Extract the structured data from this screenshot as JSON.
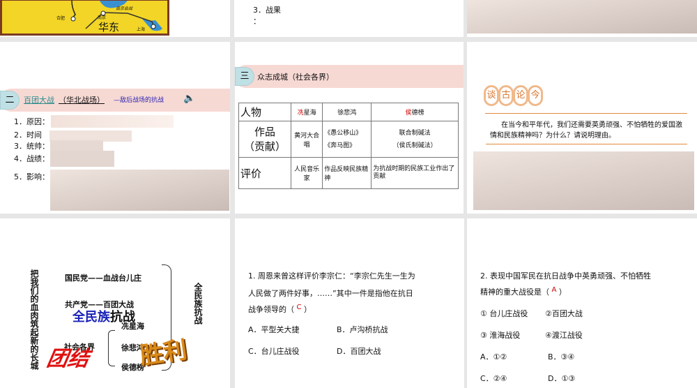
{
  "slides": {
    "map": {
      "labels": {
        "region": "华东",
        "hefei": "合肥",
        "nanjing": "南京",
        "shanghai": "上海",
        "battle": "南京会战"
      },
      "colors": {
        "land": "#f2d526",
        "water": "#3a8fd0",
        "border": "#7a3a22"
      }
    },
    "result": {
      "item": "3．战果",
      "colon": "："
    },
    "section2": {
      "badge": "二",
      "title": "百团大战",
      "subtitle": "（华北战场）",
      "tagline": "—敌后战场的抗战",
      "items": [
        "1．原因：",
        "2．时间",
        "3．统帅：",
        "4．战绩：",
        "5．影响："
      ]
    },
    "section3": {
      "badge": "三",
      "title": "众志成城（社会各界）",
      "table": {
        "row_headers": [
          "人物",
          "作品\n（贡献）",
          "评价"
        ],
        "people": [
          {
            "first": "冼",
            "rest": "星海",
            "highlight": true
          },
          {
            "first": "",
            "rest": "徐悲鸿",
            "highlight": false
          },
          {
            "first": "侯",
            "rest": "德榜",
            "highlight": true
          }
        ],
        "works": [
          "黄河大合唱",
          "《愚公移山》\n《奔马图》",
          "联合制碱法\n（侯氏制碱法）"
        ],
        "evaluations": [
          "人民音乐家",
          "作品反映民族精神",
          "为抗战时期的民族工业作出了贡献"
        ]
      }
    },
    "talk": {
      "rings": [
        "谈",
        "古",
        "论",
        "今"
      ],
      "question": "在当今和平年代，我们还需要英勇顽强、不怕牺牲的爱国激情和民族精神吗？为什么？请说明理由。"
    },
    "summary": {
      "left_vertical": "把我们的血肉筑起新的长城",
      "kmt": "国民党——血战台儿庄",
      "ccp": "共产党——百团大战",
      "wordart_blue": "全民族",
      "wordart_black": "抗战",
      "society": "社会各界",
      "people": [
        "冼星海",
        "徐悲鸿",
        "侯德榜"
      ],
      "right_vertical": "全民族抗战",
      "unity_art": "团结",
      "victory_art": "胜利"
    },
    "q1": {
      "lines": [
        "1. 周恩来曾这样评价李宗仁：“李宗仁先生一生为",
        "人民做了两件好事，……”其中一件是指他在抗日",
        "战争领导的（"
      ],
      "close": "）",
      "answer": "C",
      "options": [
        "A．平型关大捷",
        "B．卢沟桥抗战",
        "C．台儿庄战役",
        "D．百团大战"
      ]
    },
    "q2": {
      "lines": [
        "2. 表现中国军民在抗日战争中英勇顽强、不怕牺牲",
        "精神的重大战役是（"
      ],
      "close": "）",
      "answer": "A",
      "items": [
        "① 台儿庄战役",
        "②百团大战",
        "③ 淮海战役",
        "④渡江战役"
      ],
      "options": [
        "A．①②",
        "B．③④",
        "C．②④",
        "D．①③"
      ]
    }
  }
}
